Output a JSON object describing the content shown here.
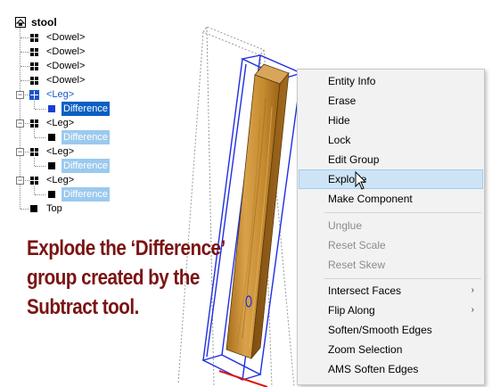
{
  "outliner": {
    "root_label": "stool",
    "items": [
      {
        "label": "<Dowel>",
        "type": "group"
      },
      {
        "label": "<Dowel>",
        "type": "group"
      },
      {
        "label": "<Dowel>",
        "type": "group"
      },
      {
        "label": "<Dowel>",
        "type": "group"
      },
      {
        "label": "<Leg>",
        "type": "group-selected",
        "child": "Difference",
        "child_state": "selected"
      },
      {
        "label": "<Leg>",
        "type": "group",
        "child": "Difference",
        "child_state": "highlighted"
      },
      {
        "label": "<Leg>",
        "type": "group",
        "child": "Difference",
        "child_state": "highlighted"
      },
      {
        "label": "<Leg>",
        "type": "group",
        "child": "Difference",
        "child_state": "highlighted"
      },
      {
        "label": "Top",
        "type": "solid"
      }
    ]
  },
  "caption": {
    "line1": "Explode the ‘Difference’",
    "line2": "group created by the",
    "line3": "Subtract tool."
  },
  "context_menu": {
    "items": [
      {
        "label": "Entity Info",
        "enabled": true
      },
      {
        "label": "Erase",
        "enabled": true
      },
      {
        "label": "Hide",
        "enabled": true
      },
      {
        "label": "Lock",
        "enabled": true
      },
      {
        "label": "Edit Group",
        "enabled": true
      },
      {
        "label": "Explode",
        "enabled": true,
        "hover": true
      },
      {
        "label": "Make Component",
        "enabled": true
      },
      {
        "separator": true
      },
      {
        "label": "Unglue",
        "enabled": false
      },
      {
        "label": "Reset Scale",
        "enabled": false
      },
      {
        "label": "Reset Skew",
        "enabled": false
      },
      {
        "separator": true
      },
      {
        "label": "Intersect Faces",
        "enabled": true,
        "submenu": true
      },
      {
        "label": "Flip Along",
        "enabled": true,
        "submenu": true
      },
      {
        "label": "Soften/Smooth Edges",
        "enabled": true
      },
      {
        "label": "Zoom Selection",
        "enabled": true
      },
      {
        "label": "AMS Soften Edges",
        "enabled": true
      }
    ]
  },
  "colors": {
    "caption": "#7a1414",
    "selection": "#0a5fc4",
    "highlight": "#9cc9ee",
    "wood": "#c8902c",
    "bounding_box": "#1f2fe0",
    "menu_hover": "#cde4f7"
  },
  "icons": {
    "root": "model-icon",
    "group": "group-icon",
    "solid": "solid-component-icon",
    "submenu": "chevron-right-icon",
    "cursor": "arrow-pointer-icon"
  }
}
